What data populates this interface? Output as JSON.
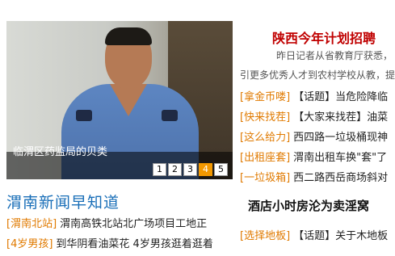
{
  "slideshow": {
    "caption": "临渭区药监局的贝类",
    "pages": [
      "1",
      "2",
      "3",
      "4",
      "5"
    ],
    "active_page": "4"
  },
  "left_section": {
    "title": "渭南新闻早知道",
    "items": [
      {
        "tag": "[渭南北站]",
        "text": "渭南高铁北站北广场项目工地正"
      },
      {
        "tag": "[4岁男孩]",
        "text": "到华阴看油菜花 4岁男孩逛着逛着"
      }
    ]
  },
  "right_section": {
    "headline": "陕西今年计划招聘",
    "summary_line1": "昨日记者从省教育厅获悉，",
    "summary_line2": "引更多优秀人才到农村学校从教，提",
    "items": [
      {
        "tag": "[拿金币喽]",
        "text": "【话题】当危险降临"
      },
      {
        "tag": "[快来找茬]",
        "text": "【大家来找茬】油菜"
      },
      {
        "tag": "[这么给力]",
        "text": "西四路一垃圾桶现神"
      },
      {
        "tag": "[出租座套]",
        "text": "渭南出租车换\"套\"了"
      },
      {
        "tag": "[一垃圾箱]",
        "text": "西二路西岳商场斜对"
      }
    ],
    "headline2": "酒店小时房沦为卖淫窝",
    "items2": [
      {
        "tag": "[选择地板]",
        "text": "【话题】关于木地板"
      }
    ]
  }
}
